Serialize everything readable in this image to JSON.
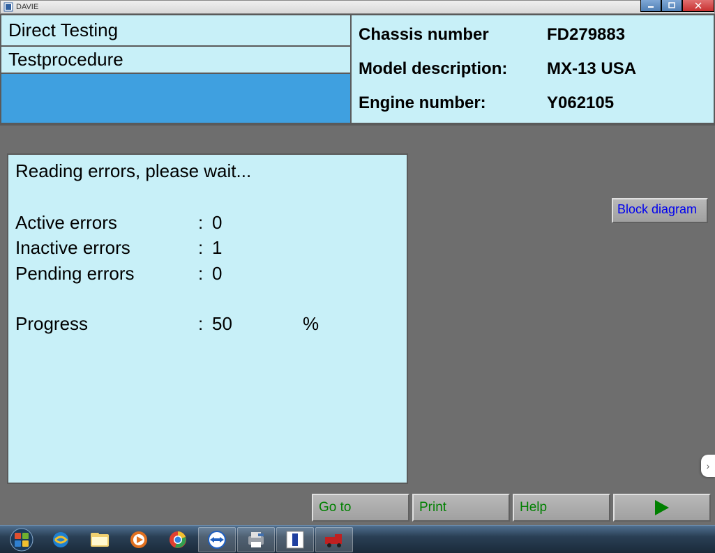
{
  "window": {
    "title": "DAVIE"
  },
  "header": {
    "left": {
      "line1": "Direct Testing",
      "line2": "Testprocedure"
    },
    "right": {
      "chassis_label": "Chassis number",
      "chassis_value": "FD279883",
      "model_label": "Model description:",
      "model_value": "MX-13 USA",
      "engine_label": "Engine number:",
      "engine_value": "Y062105"
    }
  },
  "status": {
    "title": "Reading errors, please wait...",
    "active_label": "Active errors",
    "active_value": "0",
    "inactive_label": "Inactive errors",
    "inactive_value": "1",
    "pending_label": "Pending errors",
    "pending_value": "0",
    "progress_label": "Progress",
    "progress_value": "50",
    "progress_unit": "%",
    "colon": ":"
  },
  "buttons": {
    "block_diagram": "Block diagram",
    "goto": "Go to",
    "print": "Print",
    "help": "Help"
  },
  "icons": {
    "davie": "davie-icon",
    "start": "start-icon",
    "ie": "internet-explorer-icon",
    "explorer": "file-explorer-icon",
    "media": "media-player-icon",
    "chrome": "chrome-icon",
    "teamviewer": "teamviewer-icon",
    "printer": "printer-icon",
    "app1": "davie-app-icon",
    "app2": "truck-app-icon"
  }
}
